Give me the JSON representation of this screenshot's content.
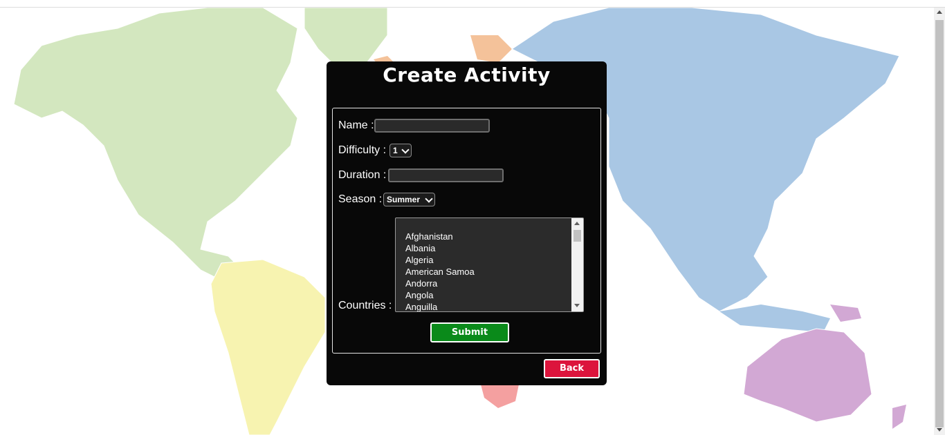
{
  "form": {
    "title": "Create Activity",
    "name_label": "Name :",
    "name_value": "",
    "difficulty_label": "Difficulty :",
    "difficulty_value": "1",
    "duration_label": "Duration :",
    "duration_value": "",
    "season_label": "Season :",
    "season_value": "Summer",
    "countries_label": "Countries :",
    "countries": [
      "Afghanistan",
      "Albania",
      "Algeria",
      "American Samoa",
      "Andorra",
      "Angola",
      "Anguilla"
    ],
    "submit_label": "Submit",
    "back_label": "Back"
  },
  "colors": {
    "panel_bg": "#080808",
    "submit": "#0a8a1a",
    "back": "#dc143c",
    "north_america": "#d3e7bf",
    "south_america": "#f7f3b0",
    "asia": "#a9c7e4",
    "oceania": "#d2a8d4",
    "europe": "#f4c29a",
    "africa": "#f4a0a0"
  },
  "icons": {
    "difficulty_select": "chevron-down-icon",
    "season_select": "chevron-down-icon",
    "list_up": "arrow-up-icon",
    "list_down": "arrow-down-icon"
  }
}
